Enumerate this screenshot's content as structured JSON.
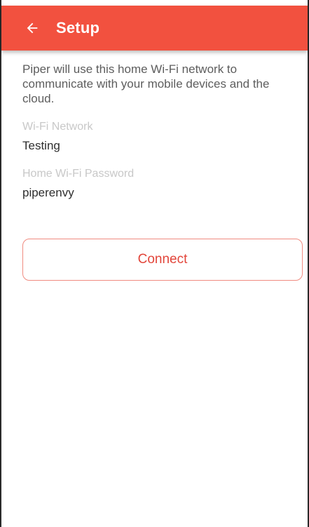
{
  "header": {
    "title": "Setup",
    "back_icon": "arrow-left-icon",
    "color": "#f2513f"
  },
  "intro_text": "Piper will use this home Wi-Fi network to communicate with your mobile devices and the cloud.",
  "wifi_network": {
    "label": "Wi-Fi Network",
    "value": "Testing"
  },
  "wifi_password": {
    "label": "Home Wi-Fi Password",
    "value": "piperenvy"
  },
  "connect_button": {
    "label": "Connect",
    "color": "#e2453a"
  }
}
